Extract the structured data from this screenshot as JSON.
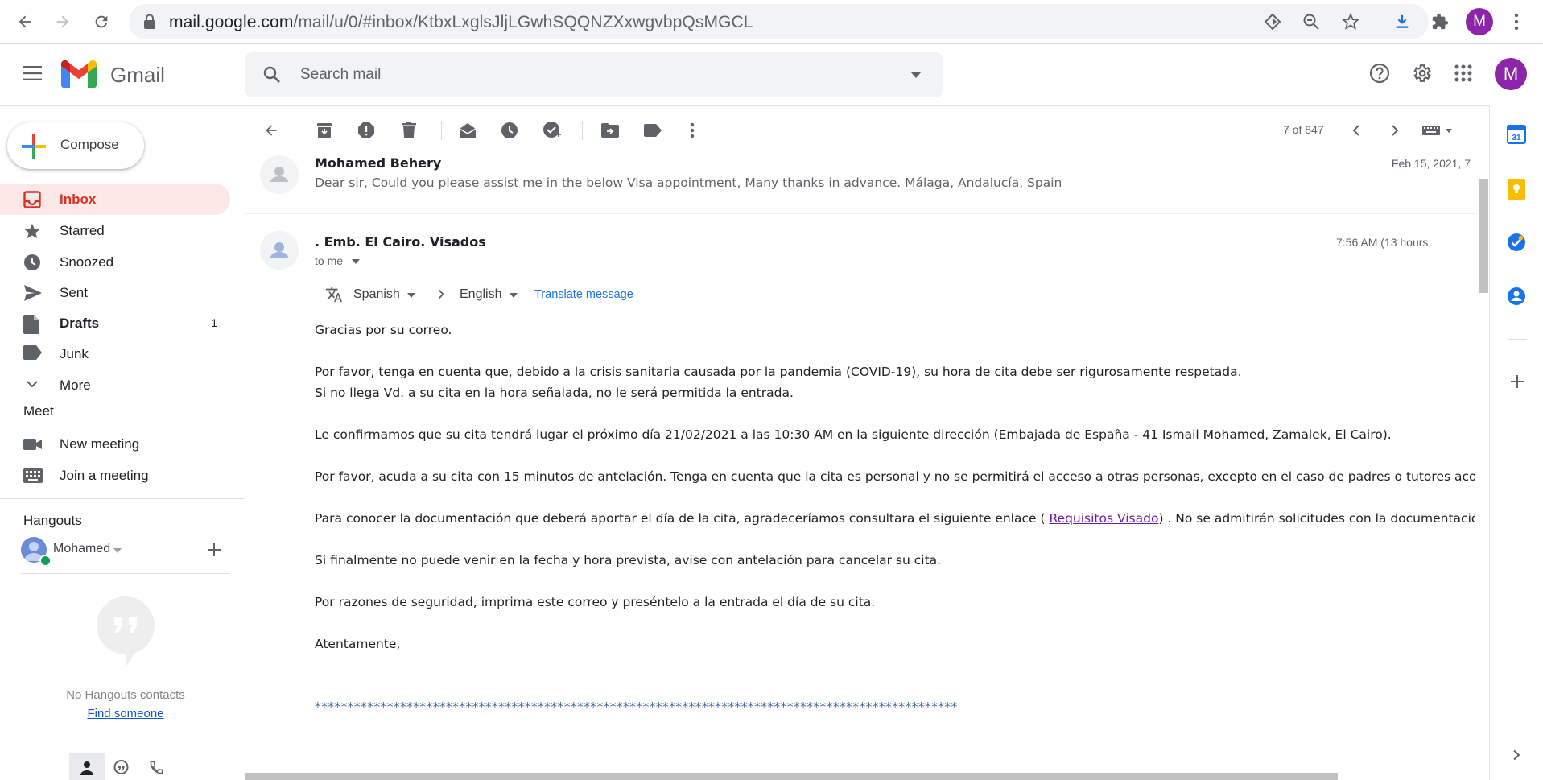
{
  "browser": {
    "url_host": "mail.google.com",
    "url_path": "/mail/u/0/#inbox/KtbxLxglsJljLGwhSQQNZXxwgvbpQsMGCL",
    "profile_initial": "M"
  },
  "header": {
    "app_name": "Gmail",
    "search_placeholder": "Search mail",
    "account_initial": "M"
  },
  "nav": {
    "compose_label": "Compose",
    "items": [
      {
        "label": "Inbox",
        "count": ""
      },
      {
        "label": "Starred",
        "count": ""
      },
      {
        "label": "Snoozed",
        "count": ""
      },
      {
        "label": "Sent",
        "count": ""
      },
      {
        "label": "Drafts",
        "count": "1"
      },
      {
        "label": "Junk",
        "count": ""
      },
      {
        "label": "More",
        "count": ""
      }
    ],
    "meet": {
      "title": "Meet",
      "new_meeting": "New meeting",
      "join_meeting": "Join a meeting"
    },
    "hangouts": {
      "title": "Hangouts",
      "user": "Mohamed",
      "empty_text": "No Hangouts contacts",
      "find_link": "Find someone"
    }
  },
  "toolbar": {
    "pagination": "7 of 847"
  },
  "thread": {
    "collapsed": {
      "sender": "Mohamed Behery",
      "snippet": "Dear sir, Could you please assist me in the below Visa appointment, Many thanks in advance. Málaga, Andalucía, Spain",
      "date": "Feb 15, 2021, 7"
    },
    "open": {
      "sender": ". Emb. El Cairo. Visados",
      "recipient": "to me",
      "time": "7:56 AM (13 hours",
      "translate": {
        "from": "Spanish",
        "to": "English",
        "action": "Translate message"
      },
      "body": {
        "p1": "Gracias por su correo.",
        "p2a": "Por favor, tenga en cuenta que, debido a la crisis sanitaria causada por la pandemia (COVID-19), su hora de cita debe ser rigurosamente respetada.",
        "p2b": "Si no llega Vd. a su cita en la hora señalada, no le será permitida la entrada.",
        "p3": "Le confirmamos que su cita tendrá lugar el próximo día 21/02/2021 a las 10:30 AM en la siguiente dirección (Embajada de España - 41 Ismail Mohamed, Zamalek, El Cairo).",
        "p4": "Por favor, acuda a su cita con 15 minutos de antelación. Tenga en cuenta que la cita es personal y no se permitirá el acceso a otras personas, excepto en el caso de padres o tutores acompañando a menores",
        "p5a": "Para conocer la documentación que deberá aportar el día de la cita, agradeceríamos consultara el siguiente enlace ( ",
        "p5_link": "Requisitos Visado",
        "p5b": ") . No se admitirán solicitudes con la documentación incompleta ni se",
        "p6": "Si finalmente no puede venir en la fecha y hora prevista, avise con antelación para cancelar su cita.",
        "p7": "Por razones de seguridad, imprima este correo y preséntelo a la entrada el día de su cita.",
        "p8": "Atentamente,",
        "stars": "**************************************************************************************************"
      }
    }
  },
  "colors": {
    "accent_red": "#d93025",
    "inbox_bg": "#fce8e6",
    "link_blue": "#1a73e8",
    "profile_purple": "#8e24aa"
  }
}
